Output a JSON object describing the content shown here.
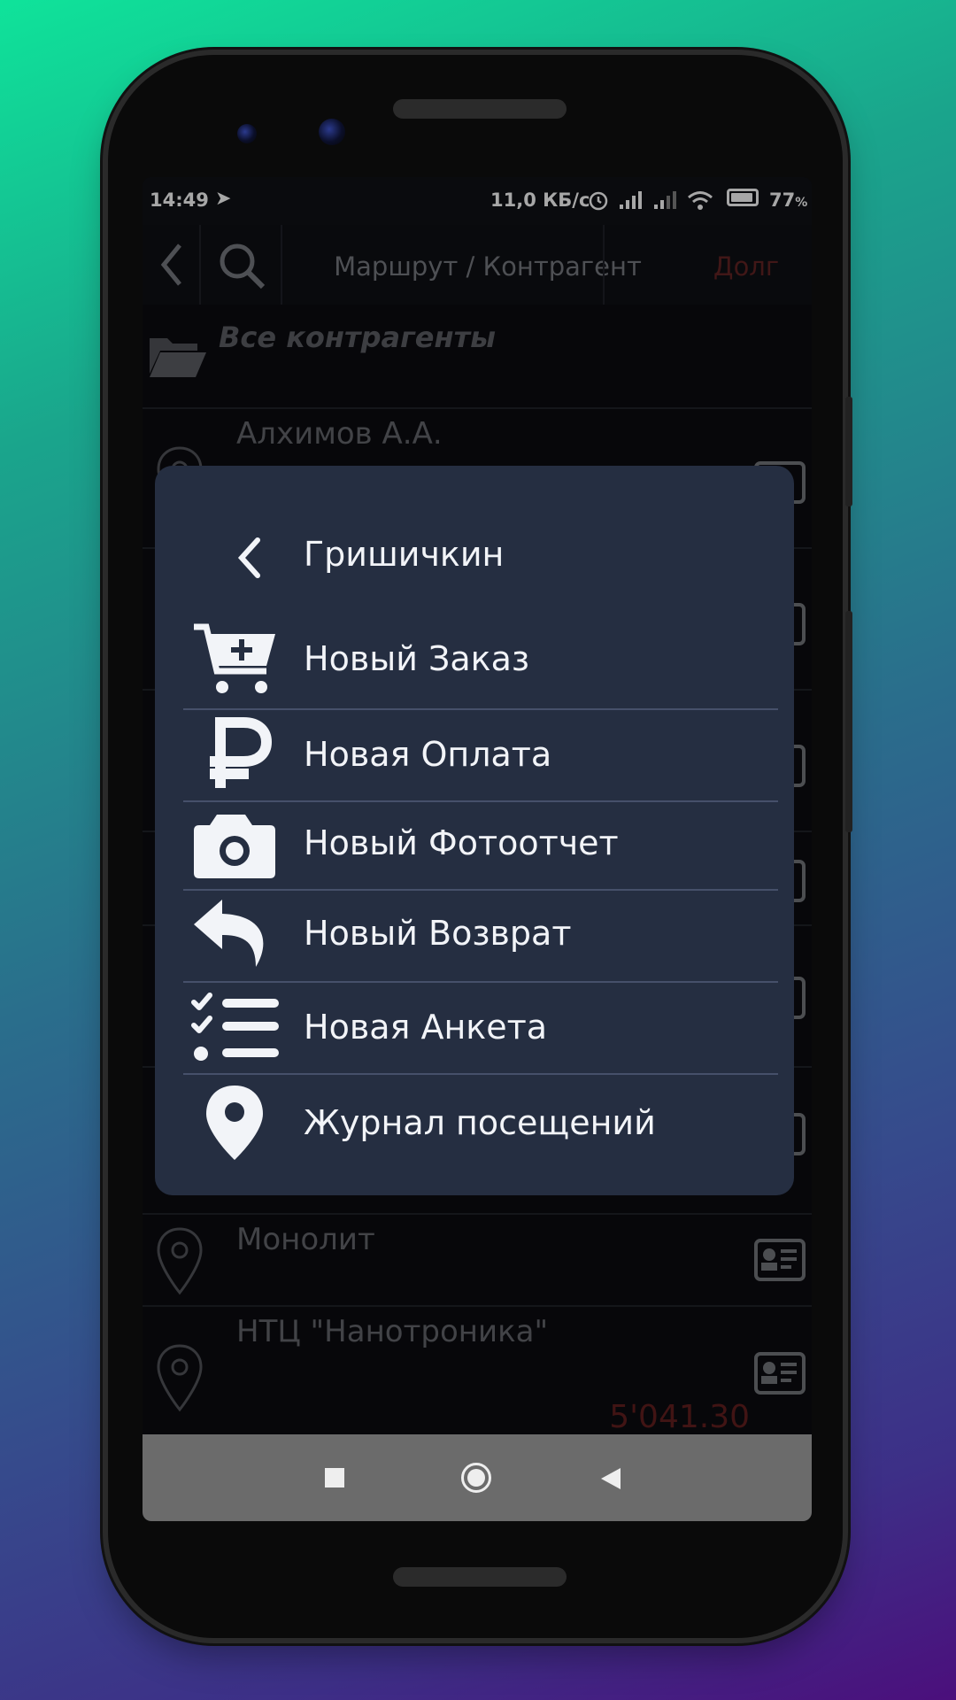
{
  "status_bar": {
    "time": "14:49",
    "telegram_icon": "telegram-icon",
    "network_speed": "11,0 КБ/с",
    "battery_percent": "77",
    "battery_unit": "%"
  },
  "toolbar": {
    "title": "Маршрут / Контрагент",
    "debt_label": "Долг"
  },
  "folder": {
    "label": "Все контрагенты"
  },
  "list": [
    {
      "name": "Алхимов А.А.",
      "amount": ""
    },
    {
      "name": "Монолит",
      "amount": ""
    },
    {
      "name": "НТЦ \"Нанотроника\"",
      "amount": "5'041.30"
    }
  ],
  "dialog": {
    "title": "Гришичкин",
    "items": [
      {
        "label": "Новый Заказ",
        "icon": "cart-plus-icon"
      },
      {
        "label": "Новая Оплата",
        "icon": "ruble-icon"
      },
      {
        "label": "Новый Фотоотчет",
        "icon": "camera-icon"
      },
      {
        "label": "Новый Возврат",
        "icon": "return-icon"
      },
      {
        "label": "Новая Анкета",
        "icon": "checklist-icon"
      },
      {
        "label": "Журнал посещений",
        "icon": "map-pin-icon"
      }
    ]
  },
  "colors": {
    "dialog_bg": "#252e41",
    "separator": "#46506a",
    "debt_red": "#5a2020",
    "navbar": "#6b6b6b"
  }
}
